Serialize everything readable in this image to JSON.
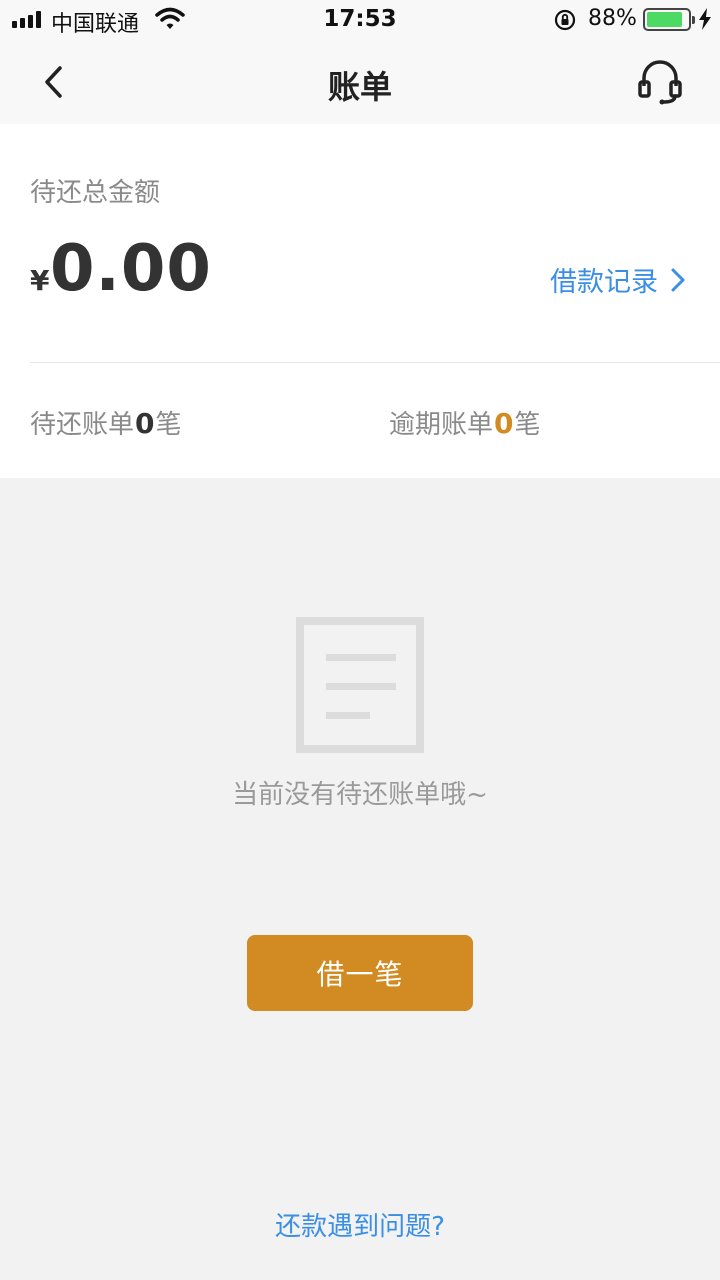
{
  "status_bar": {
    "carrier": "中国联通",
    "time": "17:53",
    "battery_percent": "88%",
    "battery_level": 0.88
  },
  "nav": {
    "title": "账单",
    "back_icon": "chevron-left-icon",
    "service_icon": "headset-icon"
  },
  "summary": {
    "label": "待还总金额",
    "currency": "¥",
    "amount": "0.00",
    "records_link": "借款记录",
    "pending": {
      "prefix": "待还账单",
      "count": "0",
      "suffix": "笔"
    },
    "overdue": {
      "prefix": "逾期账单",
      "count": "0",
      "suffix": "笔"
    }
  },
  "empty_state": {
    "icon": "document-icon",
    "message": "当前没有待还账单哦~"
  },
  "borrow_button": "借一笔",
  "help_link": "还款遇到问题?",
  "colors": {
    "accent": "#d28a22",
    "link": "#3a8ee6",
    "battery": "#4cd964"
  }
}
